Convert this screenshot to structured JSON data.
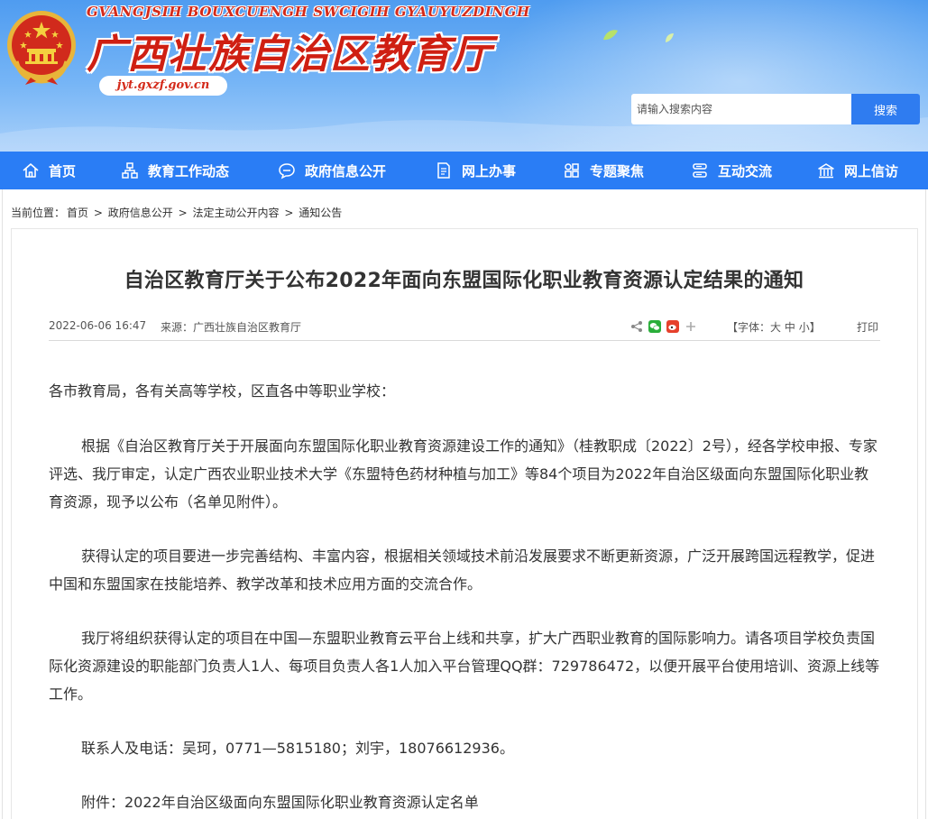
{
  "header": {
    "subtitle": "GVANGJSIH BOUXCUENGH SWCIGIH GYAUYUZDINGH",
    "title": "广西壮族自治区教育厅",
    "url": "jyt.gxzf.gov.cn",
    "search": {
      "placeholder": "请输入搜索内容",
      "button_label": "搜索"
    }
  },
  "nav": {
    "items": [
      {
        "label": "首页",
        "icon": "home-icon"
      },
      {
        "label": "教育工作动态",
        "icon": "org-chart-icon"
      },
      {
        "label": "政府信息公开",
        "icon": "chat-bubble-icon"
      },
      {
        "label": "网上办事",
        "icon": "document-edit-icon"
      },
      {
        "label": "专题聚焦",
        "icon": "grid-icon"
      },
      {
        "label": "互动交流",
        "icon": "server-stack-icon"
      },
      {
        "label": "网上信访",
        "icon": "building-icon"
      }
    ]
  },
  "breadcrumb": {
    "prefix": "当前位置：",
    "items": [
      "首页",
      "政府信息公开",
      "法定主动公开内容",
      "通知公告"
    ],
    "separator": ">"
  },
  "article": {
    "title": "自治区教育厅关于公布2022年面向东盟国际化职业教育资源认定结果的通知",
    "date": "2022-06-06 16:47",
    "source": "来源：广西壮族自治区教育厅",
    "font_size_prefix": "【字体：",
    "font_size_options": [
      "大",
      "中",
      "小"
    ],
    "font_size_suffix": "】",
    "print_label": "打印",
    "greeting": "各市教育局，各有关高等学校，区直各中等职业学校：",
    "paragraphs": [
      "根据《自治区教育厅关于开展面向东盟国际化职业教育资源建设工作的通知》（桂教职成〔2022〕2号），经各学校申报、专家评选、我厅审定，认定广西农业职业技术大学《东盟特色药材种植与加工》等84个项目为2022年自治区级面向东盟国际化职业教育资源，现予以公布（名单见附件）。",
      "获得认定的项目要进一步完善结构、丰富内容，根据相关领域技术前沿发展要求不断更新资源，广泛开展跨国远程教学，促进中国和东盟国家在技能培养、教学改革和技术应用方面的交流合作。",
      "我厅将组织获得认定的项目在中国—东盟职业教育云平台上线和共享，扩大广西职业教育的国际影响力。请各项目学校负责国际化资源建设的职能部门负责人1人、每项目负责人各1人加入平台管理QQ群：729786472，以便开展平台使用培训、资源上线等工作。",
      "联系人及电话：吴珂，0771—5815180；刘宇，18076612936。",
      "附件：2022年自治区级面向东盟国际化职业教育资源认定名单"
    ]
  },
  "colors": {
    "nav_bg": "#2a7df5",
    "title_red": "#cf1f12",
    "search_button": "#2f7cf0"
  }
}
